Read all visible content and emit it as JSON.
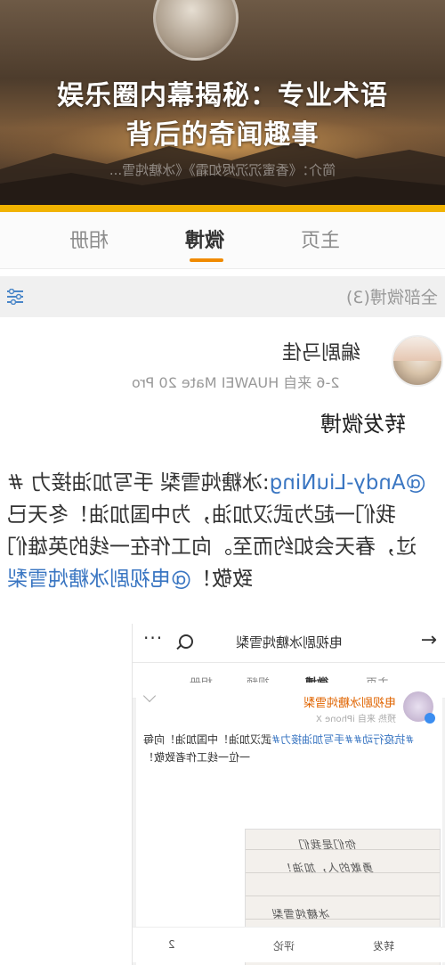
{
  "hero": {
    "title_line1": "娱乐圈内幕揭秘：专业术语",
    "title_line2": "背后的奇闻趣事",
    "intro": "简介：《香蜜沉沉烬如霜》《冰糖炖雪..."
  },
  "tabs": [
    {
      "label": "主页"
    },
    {
      "label": "微博",
      "active": true
    },
    {
      "label": "相册"
    }
  ],
  "all_weibo": {
    "label": "全部微博(3)"
  },
  "post": {
    "author": "编剧马佳",
    "meta": "2-6  来自 HUAWEI Mate 20 Pro",
    "repost_label": "转发微博",
    "line1_mention": "@Andy-LiuNing",
    "line1_text": ":冰糖炖雪梨 手写加油接力 #",
    "line2": "我们一起为武汉加油，为中国加油！冬天已",
    "line3": "过，春天会如约而至。向工作在一线的英雄们",
    "line4_prefix": "致敬！",
    "line4_mention": "@电视剧冰糖炖雪梨"
  },
  "embedded": {
    "nav_title": "电视剧冰糖炖雪梨",
    "back_glyph": "→",
    "more_glyph": "···",
    "tabs": [
      {
        "label": "主页"
      },
      {
        "label": "微博",
        "active": true
      },
      {
        "label": "视频"
      },
      {
        "label": "相册"
      }
    ],
    "author": "电视剧冰糖炖雪梨",
    "meta": "预热 来自 iPhone X",
    "text_line1_tag": "#抗疫行动##手写加油接力#",
    "text_line1_rest": "武汉加油！中国加油！向每",
    "text_line2": "一位一线工作者致敬！",
    "handwriting": [
      "冰糖炖雪梨",
      "你们是我们",
      "勇敢的人，加油！",
      "冰糖炖雪梨"
    ],
    "actions": {
      "repost": "转发",
      "comment": "评论",
      "like": "2"
    }
  }
}
